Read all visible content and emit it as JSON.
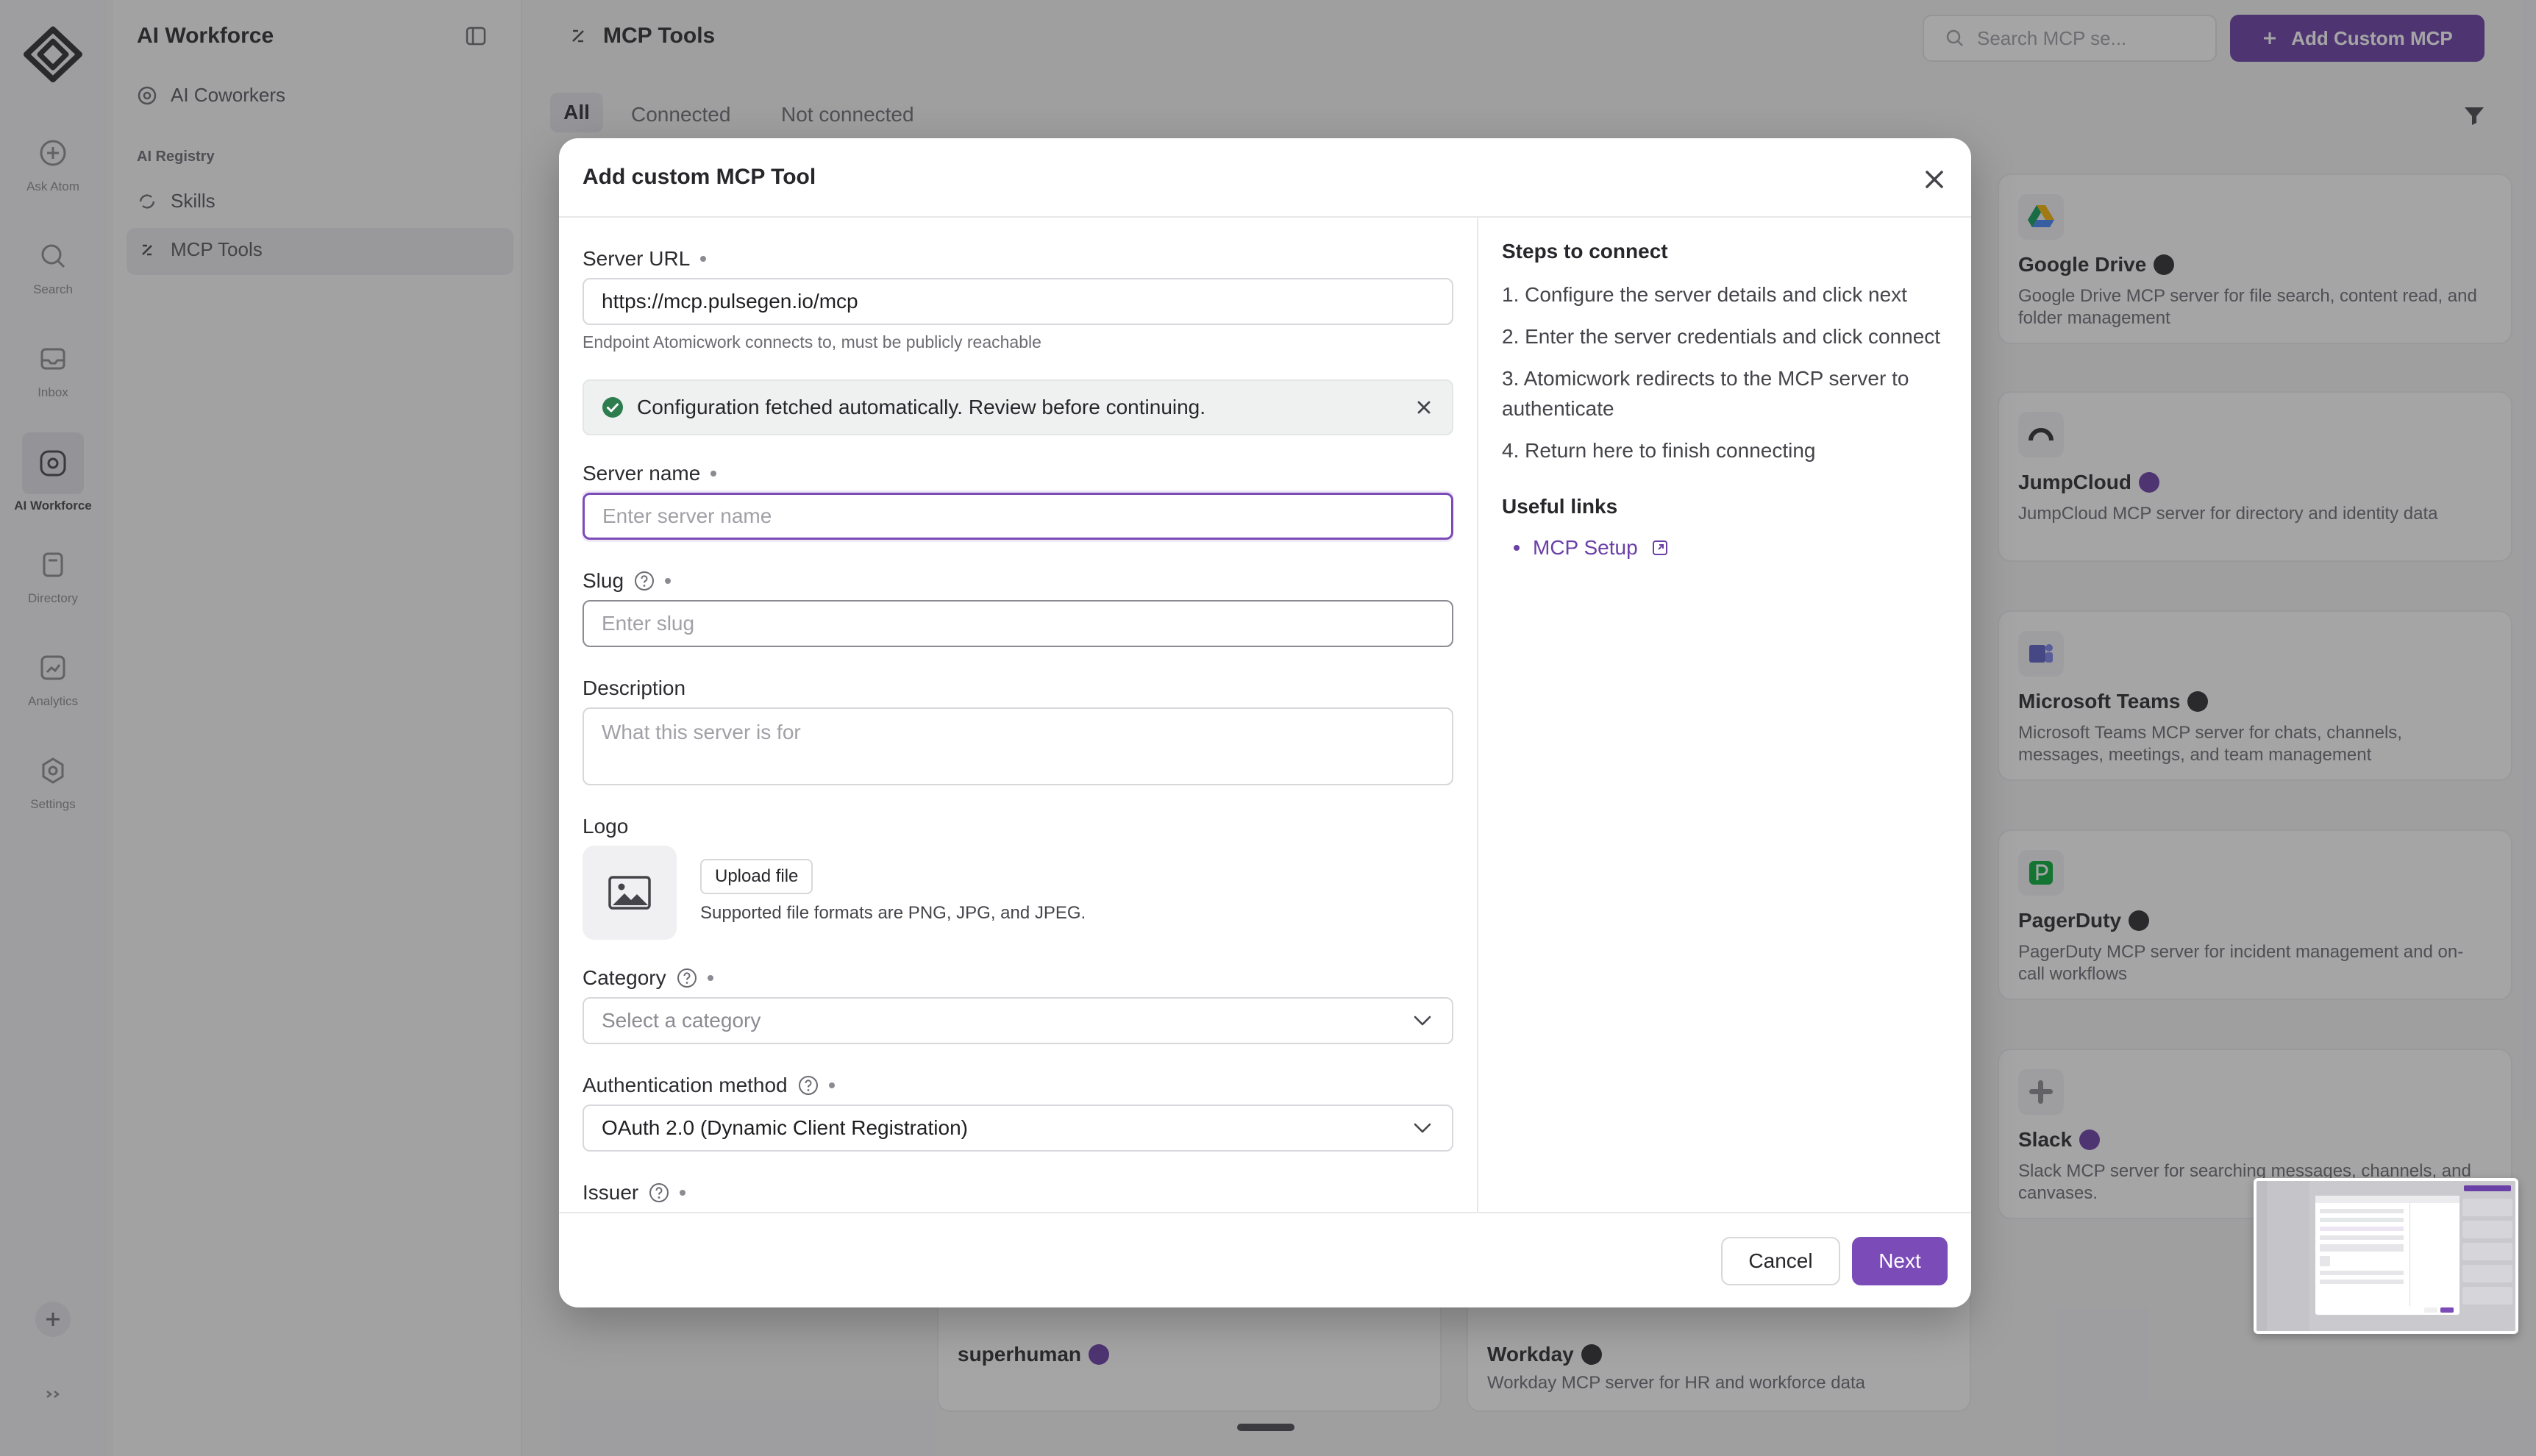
{
  "sidebar_rail": {
    "items": [
      {
        "label": "Ask Atom",
        "icon": "plus-circle-icon"
      },
      {
        "label": "Search",
        "icon": "search-icon"
      },
      {
        "label": "Inbox",
        "icon": "inbox-icon"
      },
      {
        "label": "AI Workforce",
        "icon": "ai-workforce-icon"
      },
      {
        "label": "Directory",
        "icon": "directory-icon"
      },
      {
        "label": "Analytics",
        "icon": "analytics-icon"
      },
      {
        "label": "Settings",
        "icon": "gear-icon"
      }
    ]
  },
  "side_panel": {
    "title": "AI Workforce",
    "coworkers": "AI Coworkers",
    "section": "AI Registry",
    "skills": "Skills",
    "mcp_tools": "MCP Tools"
  },
  "header": {
    "title": "MCP Tools",
    "search_placeholder": "Search MCP se...",
    "add_button": "Add Custom MCP"
  },
  "filters": {
    "all": "All",
    "connected": "Connected",
    "not_connected": "Not connected"
  },
  "cards": {
    "google_drive": {
      "name": "Google Drive",
      "desc": "Google Drive MCP server for file search, content read, and folder management"
    },
    "jumpcloud": {
      "name": "JumpCloud",
      "desc": "JumpCloud MCP server for directory and identity data"
    },
    "teams": {
      "name": "Microsoft Teams",
      "desc": "Microsoft Teams MCP server for chats, channels, messages, meetings, and team management"
    },
    "pagerduty": {
      "name": "PagerDuty",
      "desc": "PagerDuty MCP server for incident management and on-call workflows"
    },
    "slack": {
      "name": "Slack",
      "desc": "Slack MCP server for searching messages, channels, and canvases."
    },
    "superhuman": {
      "name": "superhuman"
    },
    "workday": {
      "name": "Workday",
      "desc": "Workday MCP server for HR and workforce data"
    }
  },
  "modal": {
    "title": "Add custom MCP Tool",
    "server_url": {
      "label": "Server URL",
      "value": "https://mcp.pulsegen.io/mcp",
      "hint": "Endpoint Atomicwork connects to, must be publicly reachable"
    },
    "notice": "Configuration fetched automatically. Review before continuing.",
    "server_name": {
      "label": "Server name",
      "placeholder": "Enter server name"
    },
    "slug": {
      "label": "Slug",
      "placeholder": "Enter slug"
    },
    "description": {
      "label": "Description",
      "placeholder": "What this server is for"
    },
    "logo": {
      "label": "Logo",
      "upload": "Upload file",
      "hint": "Supported file formats are PNG, JPG, and JPEG."
    },
    "category": {
      "label": "Category",
      "placeholder": "Select a category"
    },
    "auth": {
      "label": "Authentication method",
      "value": "OAuth 2.0 (Dynamic Client Registration)"
    },
    "issuer": {
      "label": "Issuer"
    },
    "steps_title": "Steps to connect",
    "steps": [
      "1. Configure the server details and click next",
      "2. Enter the server credentials and click connect",
      "3. Atomicwork redirects to the MCP server to authenticate",
      "4. Return here to finish connecting"
    ],
    "links_title": "Useful links",
    "link": "MCP Setup",
    "cancel": "Cancel",
    "next": "Next"
  },
  "colors": {
    "accent": "#7b4bb8",
    "brand": "#6a3fa6",
    "success": "#2e7d4f"
  }
}
